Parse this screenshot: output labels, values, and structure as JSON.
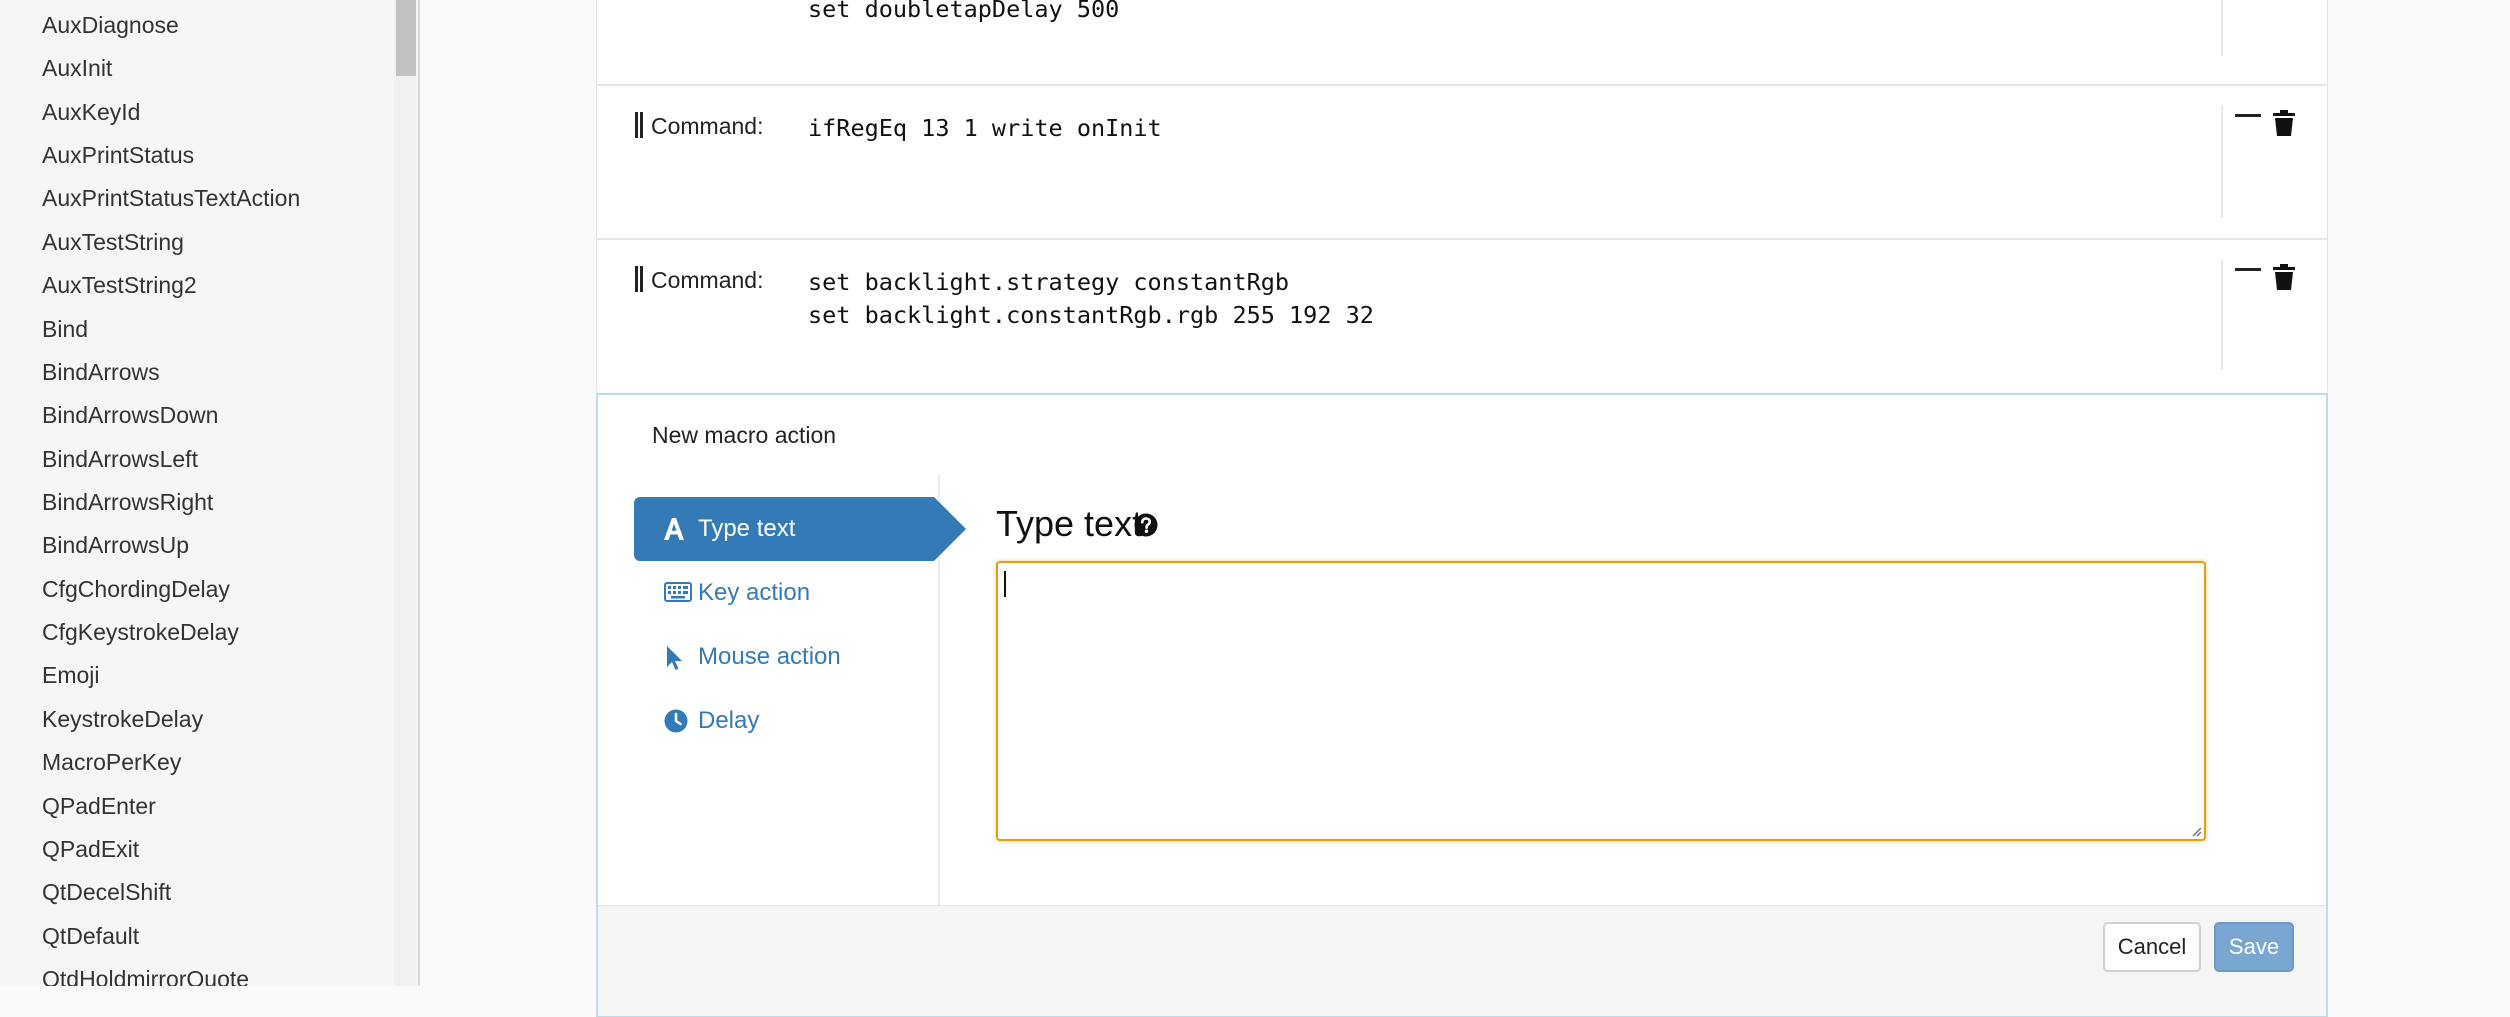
{
  "sidebar": {
    "items": [
      {
        "label": "AuxDiagnose"
      },
      {
        "label": "AuxInit"
      },
      {
        "label": "AuxKeyId"
      },
      {
        "label": "AuxPrintStatus"
      },
      {
        "label": "AuxPrintStatusTextAction"
      },
      {
        "label": "AuxTestString"
      },
      {
        "label": "AuxTestString2"
      },
      {
        "label": "Bind"
      },
      {
        "label": "BindArrows"
      },
      {
        "label": "BindArrowsDown"
      },
      {
        "label": "BindArrowsLeft"
      },
      {
        "label": "BindArrowsRight"
      },
      {
        "label": "BindArrowsUp"
      },
      {
        "label": "CfgChordingDelay"
      },
      {
        "label": "CfgKeystrokeDelay"
      },
      {
        "label": "Emoji"
      },
      {
        "label": "KeystrokeDelay"
      },
      {
        "label": "MacroPerKey"
      },
      {
        "label": "QPadEnter"
      },
      {
        "label": "QPadExit"
      },
      {
        "label": "QtDecelShift"
      },
      {
        "label": "QtDefault"
      },
      {
        "label": "QtdHoldmirrorQuote"
      }
    ]
  },
  "commands": [
    {
      "label": "Command:",
      "lines": [
        "set doubletapDelay 500"
      ]
    },
    {
      "label": "Command:",
      "lines": [
        "ifRegEq 13 1 write onInit"
      ]
    },
    {
      "label": "Command:",
      "lines": [
        "set backlight.strategy constantRgb",
        "set backlight.constantRgb.rgb 255 192 32"
      ]
    }
  ],
  "new_action": {
    "title": "New macro action",
    "tabs": [
      {
        "label": "Type text",
        "icon": "font-icon",
        "active": true
      },
      {
        "label": "Key action",
        "icon": "keyboard-icon",
        "active": false
      },
      {
        "label": "Mouse action",
        "icon": "mouse-pointer-icon",
        "active": false
      },
      {
        "label": "Delay",
        "icon": "clock-icon",
        "active": false
      }
    ],
    "content_title": "Type text",
    "textarea_value": "",
    "cancel_label": "Cancel",
    "save_label": "Save"
  },
  "colors": {
    "accent": "#337ab7",
    "textarea_focus": "#e59d19",
    "save_disabled": "#7aa7d1"
  }
}
